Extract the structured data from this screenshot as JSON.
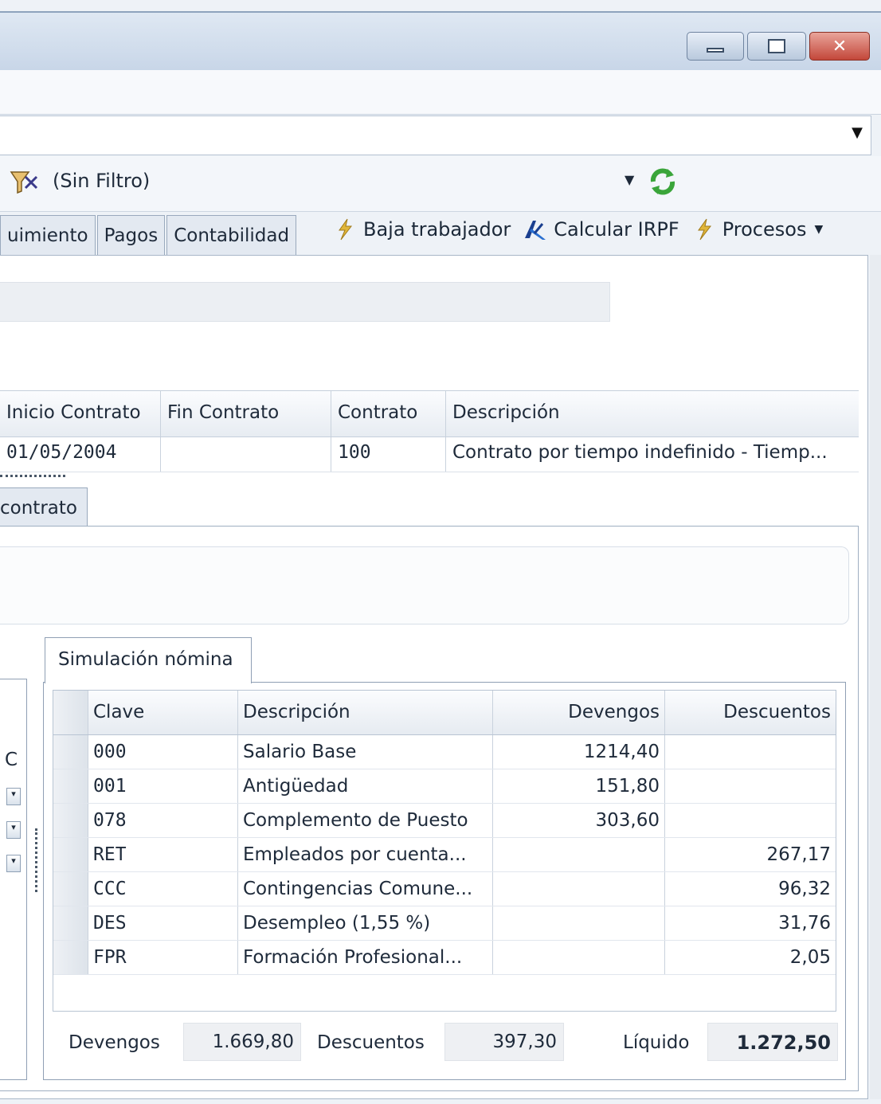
{
  "window": {
    "controls": {
      "minimize": "minimize-icon",
      "maximize": "maximize-icon",
      "close": "close-icon"
    }
  },
  "filter": {
    "label": "(Sin Filtro)"
  },
  "tabs": [
    {
      "label": "uimiento"
    },
    {
      "label": "Pagos"
    },
    {
      "label": "Contabilidad"
    }
  ],
  "actions": [
    {
      "label": "Baja trabajador",
      "icon": "lightning-icon"
    },
    {
      "label": "Calcular IRPF",
      "icon": "tax-agency-icon"
    },
    {
      "label": "Procesos",
      "icon": "lightning-icon"
    }
  ],
  "contract_grid": {
    "columns": [
      "Inicio Contrato",
      "Fin Contrato",
      "Contrato",
      "Descripción"
    ],
    "rows": [
      [
        "01/05/2004",
        "",
        "100",
        "Contrato por tiempo indefinido - Tiemp..."
      ]
    ]
  },
  "contract_tab": {
    "label": "contrato"
  },
  "left_panel": {
    "column_label": "C"
  },
  "simulation": {
    "tab_label": "Simulación nómina",
    "columns": [
      "Clave",
      "Descripción",
      "Devengos",
      "Descuentos"
    ],
    "rows": [
      [
        "000",
        "Salario Base",
        "1214,40",
        ""
      ],
      [
        "001",
        "Antigüedad",
        "151,80",
        ""
      ],
      [
        "078",
        "Complemento de Puesto",
        "303,60",
        ""
      ],
      [
        "RET",
        "Empleados por cuenta...",
        "",
        "267,17"
      ],
      [
        "CCC",
        "Contingencias Comune...",
        "",
        "96,32"
      ],
      [
        "DES",
        "Desempleo (1,55 %)",
        "",
        "31,76"
      ],
      [
        "FPR",
        "Formación Profesional...",
        "",
        "2,05"
      ]
    ],
    "totals": {
      "devengos_label": "Devengos",
      "devengos_value": "1.669,80",
      "descuentos_label": "Descuentos",
      "descuentos_value": "397,30",
      "liquido_label": "Líquido",
      "liquido_value": "1.272,50"
    }
  },
  "colors": {
    "titlebar": "#c8d6e8",
    "close_button": "#c3473a",
    "accent_green": "#3aa53a",
    "lightning": "#e0b63a"
  }
}
